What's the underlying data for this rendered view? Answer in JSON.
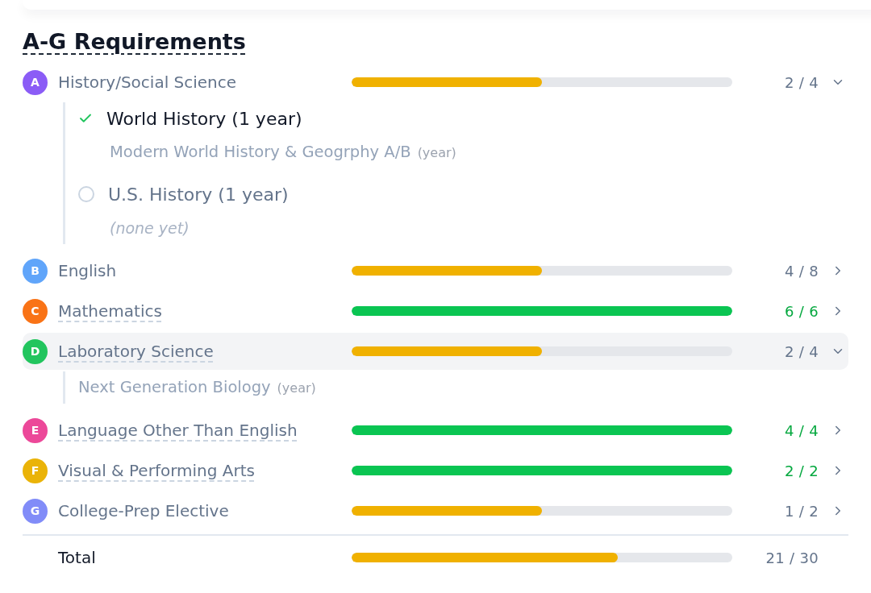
{
  "title": "A-G Requirements",
  "categories": [
    {
      "letter": "A",
      "color": "#8b5cf6",
      "name": "History/Social Science",
      "underlined": false,
      "level": 0.5,
      "count": "2 / 4",
      "expanded": true,
      "highlighted": false,
      "children": [
        {
          "kind": "requirement",
          "label": "World History (1 year)",
          "met": true,
          "children": [
            {
              "kind": "course",
              "name": "Modern World History & Geogrphy A/B",
              "term": "(year)"
            }
          ]
        },
        {
          "kind": "requirement",
          "label": "U.S. History (1 year)",
          "met": false,
          "children": [
            {
              "kind": "note",
              "text": "(none yet)"
            }
          ]
        }
      ]
    },
    {
      "letter": "B",
      "color": "#60a5fa",
      "name": "English",
      "underlined": false,
      "level": 0.5,
      "count": "4 / 8",
      "expanded": false,
      "highlighted": false
    },
    {
      "letter": "C",
      "color": "#f97316",
      "name": "Mathematics",
      "underlined": true,
      "level": 1,
      "count": "6 / 6",
      "expanded": false,
      "highlighted": false
    },
    {
      "letter": "D",
      "color": "#22c55e",
      "name": "Laboratory Science",
      "underlined": true,
      "level": 0.5,
      "count": "2 / 4",
      "expanded": true,
      "highlighted": true,
      "children": [
        {
          "kind": "course",
          "name": "Next Generation Biology",
          "term": "(year)"
        }
      ]
    },
    {
      "letter": "E",
      "color": "#ec4899",
      "name": "Language Other Than English",
      "underlined": true,
      "level": 1,
      "count": "4 / 4",
      "expanded": false,
      "highlighted": false
    },
    {
      "letter": "F",
      "color": "#eab308",
      "name": "Visual & Performing Arts",
      "underlined": true,
      "level": 1,
      "count": "2 / 2",
      "expanded": false,
      "highlighted": false
    },
    {
      "letter": "G",
      "color": "#818cf8",
      "name": "College-Prep Elective",
      "underlined": false,
      "level": 0.5,
      "count": "1 / 2",
      "expanded": false,
      "highlighted": false
    }
  ],
  "total": {
    "label": "Total",
    "level": 0.7,
    "count": "21 / 30"
  }
}
